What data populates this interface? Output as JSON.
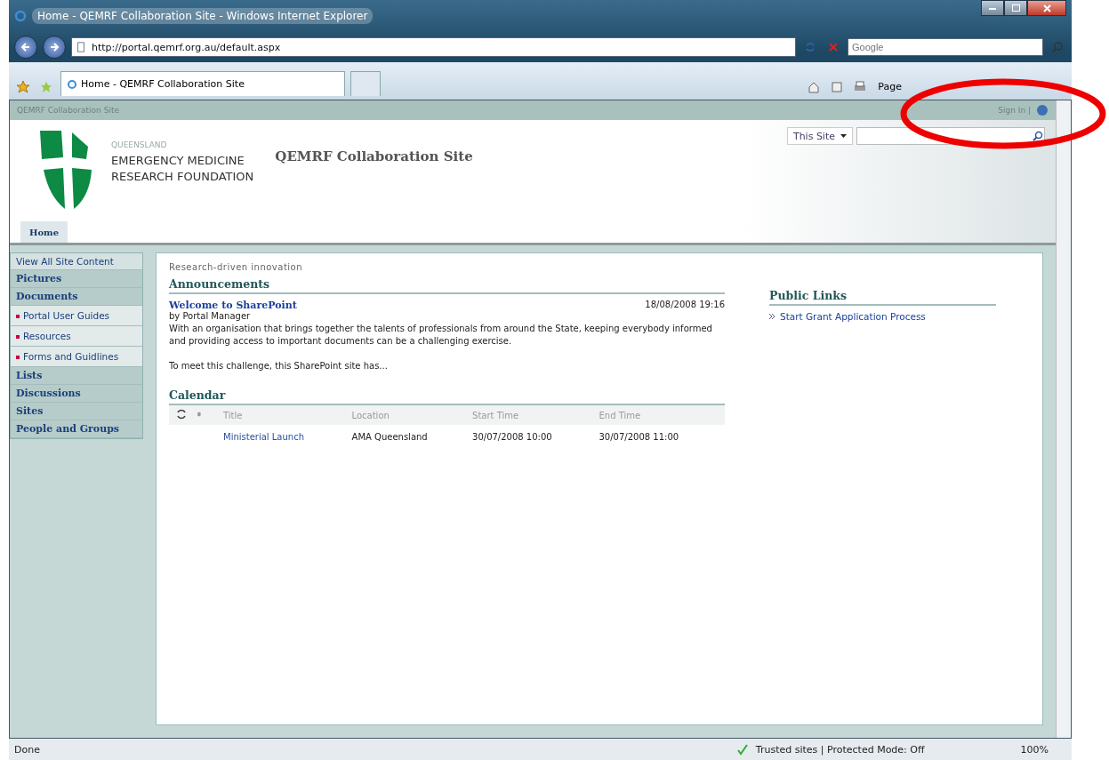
{
  "window": {
    "title": "Home - QEMRF Collaboration Site - Windows Internet Explorer"
  },
  "address_bar": {
    "url": "http://portal.qemrf.org.au/default.aspx"
  },
  "search": {
    "placeholder": "Google"
  },
  "tabs": [
    {
      "label": "Home - QEMRF Collaboration Site",
      "selected": true
    }
  ],
  "command_bar": [
    "Page"
  ],
  "site_bar": {
    "title": "QEMRF Collaboration Site",
    "sign_in": "Sign In |"
  },
  "header": {
    "org_lines": [
      "QUEENSLAND",
      "EMERGENCY MEDICINE",
      "RESEARCH FOUNDATION"
    ],
    "site_title": "QEMRF Collaboration Site",
    "scope": "This Site",
    "nav_tabs": [
      {
        "label": "Home",
        "selected": true
      }
    ]
  },
  "sidebar": {
    "items": [
      {
        "kind": "top",
        "label": "View All Site Content"
      },
      {
        "kind": "heading",
        "label": "Pictures"
      },
      {
        "kind": "heading",
        "label": "Documents"
      },
      {
        "kind": "sub",
        "label": "Portal User Guides"
      },
      {
        "kind": "sub",
        "label": "Resources"
      },
      {
        "kind": "sub",
        "label": "Forms and Guidlines"
      },
      {
        "kind": "heading",
        "label": "Lists"
      },
      {
        "kind": "heading",
        "label": "Discussions"
      },
      {
        "kind": "heading",
        "label": "Sites"
      },
      {
        "kind": "heading",
        "label": "People and Groups"
      }
    ]
  },
  "main": {
    "tagline": "Research-driven innovation",
    "announcements": {
      "title": "Announcements",
      "items": [
        {
          "title": "Welcome to SharePoint",
          "date": "18/08/2008 19:16",
          "author": "by Portal Manager",
          "body": [
            "With an organisation that brings together the talents of professionals from around the State, keeping everybody informed and providing access to important documents can be a challenging exercise.",
            "To meet this challenge, this SharePoint site has..."
          ]
        }
      ]
    },
    "calendar": {
      "title": "Calendar",
      "columns": [
        "Title",
        "Location",
        "Start Time",
        "End Time"
      ],
      "rows": [
        [
          "Ministerial Launch",
          "AMA Queensland",
          "30/07/2008 10:00",
          "30/07/2008 11:00"
        ]
      ]
    },
    "public_links": {
      "title": "Public Links",
      "items": [
        "Start Grant Application Process"
      ]
    }
  },
  "status_bar": {
    "text": "Done",
    "zone": "Trusted sites | Protected Mode: Off",
    "zoom": "100%"
  }
}
